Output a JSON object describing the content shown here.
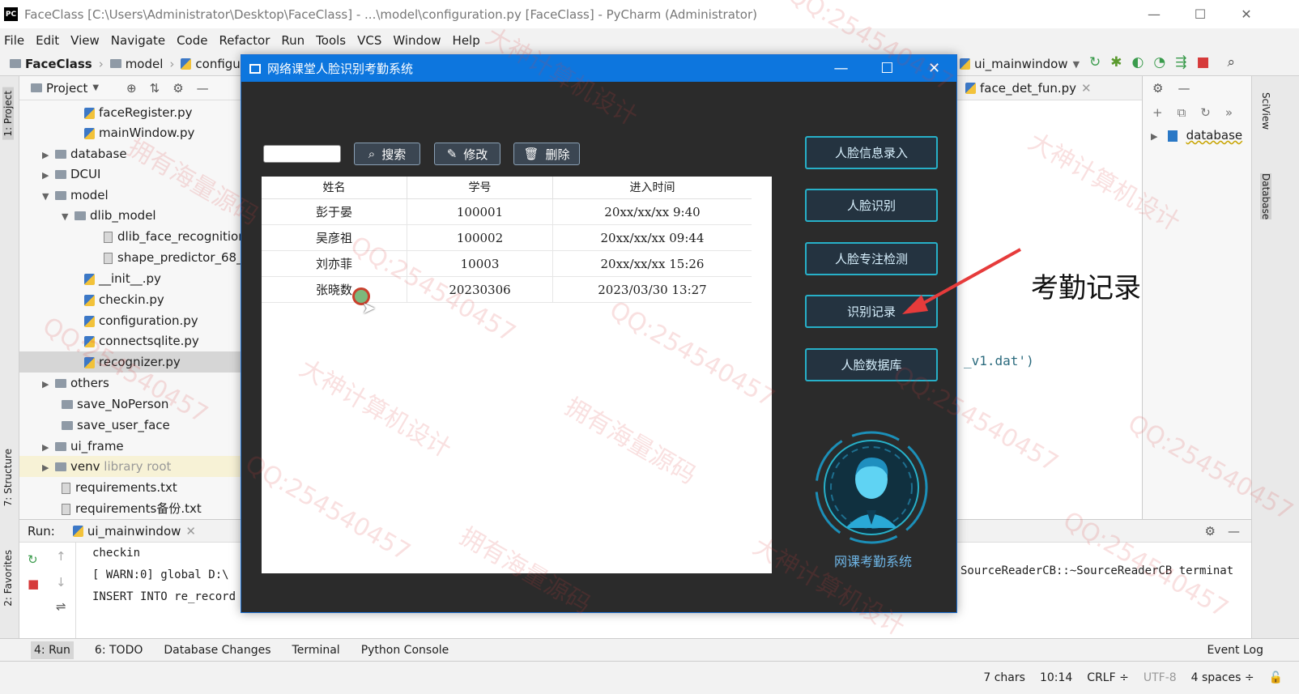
{
  "window": {
    "title": "FaceClass [C:\\Users\\Administrator\\Desktop\\FaceClass] - ...\\model\\configuration.py [FaceClass] - PyCharm (Administrator)",
    "minimize": "—",
    "maximize": "☐",
    "close": "✕"
  },
  "menu": [
    "File",
    "Edit",
    "View",
    "Navigate",
    "Code",
    "Refactor",
    "Run",
    "Tools",
    "VCS",
    "Window",
    "Help"
  ],
  "navbar": {
    "crumbs": [
      "FaceClass",
      "model",
      "configurat"
    ],
    "run_config": "ui_mainwindow"
  },
  "left_stripe": {
    "project": "1: Project",
    "structure": "7: Structure",
    "favorites": "2: Favorites"
  },
  "right_stripe": {
    "sciview": "SciView",
    "database": "Database"
  },
  "project": {
    "header": "Project",
    "items": [
      {
        "label": "faceRegister.py"
      },
      {
        "label": "mainWindow.py"
      },
      {
        "label": "database"
      },
      {
        "label": "DCUI"
      },
      {
        "label": "model"
      },
      {
        "label": "dlib_model"
      },
      {
        "label": "dlib_face_recognition"
      },
      {
        "label": "shape_predictor_68_f"
      },
      {
        "label": "__init__.py"
      },
      {
        "label": "checkin.py"
      },
      {
        "label": "configuration.py"
      },
      {
        "label": "connectsqlite.py"
      },
      {
        "label": "recognizer.py"
      },
      {
        "label": "others"
      },
      {
        "label": "save_NoPerson"
      },
      {
        "label": "save_user_face"
      },
      {
        "label": "ui_frame"
      },
      {
        "label": "venv",
        "suffix": "library root"
      },
      {
        "label": "requirements.txt"
      },
      {
        "label": "requirements备份.txt"
      }
    ]
  },
  "editor": {
    "tab": "face_det_fun.py",
    "code_fragment": "_v1.dat')"
  },
  "db_panel": {
    "item": "database"
  },
  "run": {
    "label": "Run:",
    "config": "ui_mainwindow",
    "lines": [
      "checkin",
      "[ WARN:0] global D:\\",
      "INSERT INTO re_record"
    ],
    "right_line": "SourceReaderCB::~SourceReaderCB terminat"
  },
  "bottom_tools": [
    "4: Run",
    "6: TODO",
    "Database Changes",
    "Terminal",
    "Python Console",
    "Event Log"
  ],
  "status": [
    "7 chars",
    "10:14",
    "CRLF ÷",
    "UTF-8",
    "4 spaces ÷"
  ],
  "dialog": {
    "title": "网络课堂人脸识别考勤系统",
    "search_value": "",
    "buttons": {
      "search": "搜索",
      "edit": "修改",
      "delete": "删除"
    },
    "table": {
      "headers": [
        "姓名",
        "学号",
        "进入时间"
      ],
      "rows": [
        [
          "彭于晏",
          "100001",
          "20xx/xx/xx 9:40"
        ],
        [
          "吴彦祖",
          "100002",
          "20xx/xx/xx 09:44"
        ],
        [
          "刘亦菲",
          "10003",
          "20xx/xx/xx 15:26"
        ],
        [
          "张晓数",
          "20230306",
          "2023/03/30 13:27"
        ]
      ]
    },
    "side_buttons": [
      "人脸信息录入",
      "人脸识别",
      "人脸专注检测",
      "识别记录",
      "人脸数据库"
    ],
    "logo_label": "网课考勤系统"
  },
  "annotation": "考勤记录",
  "watermark": {
    "qq": "QQ:254540457",
    "t1": "大神计算机设计",
    "t2": "拥有海量源码"
  },
  "colors": {
    "accent_blue": "#0d76de",
    "side_border": "#27b0c8",
    "dialog_bg": "#2b2b2b",
    "arrow": "#e63b3b"
  }
}
